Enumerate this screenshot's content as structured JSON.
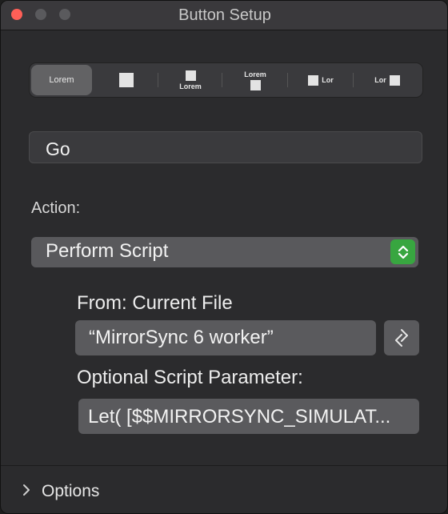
{
  "window": {
    "title": "Button Setup"
  },
  "style_segments": [
    {
      "label": "Lorem",
      "icon": "text-only"
    },
    {
      "label": "",
      "icon": "square"
    },
    {
      "label": "Lorem",
      "icon": "square-above-text"
    },
    {
      "label": "Lorem",
      "icon": "text-above-square"
    },
    {
      "label": "Lor",
      "icon": "square-left-of-text"
    },
    {
      "label": "Lor",
      "icon": "text-left-of-square"
    }
  ],
  "button_label": {
    "value": "Go"
  },
  "action": {
    "label": "Action:",
    "selected": "Perform Script"
  },
  "script": {
    "from_label": "From: Current File",
    "script_name": "“MirrorSync 6 worker”",
    "param_label": "Optional Script Parameter:",
    "param_value": "Let( [$$MIRRORSYNC_SIMULAT..."
  },
  "options": {
    "label": "Options"
  },
  "colors": {
    "accent_green": "#38a640",
    "close_red": "#ff5f57"
  }
}
